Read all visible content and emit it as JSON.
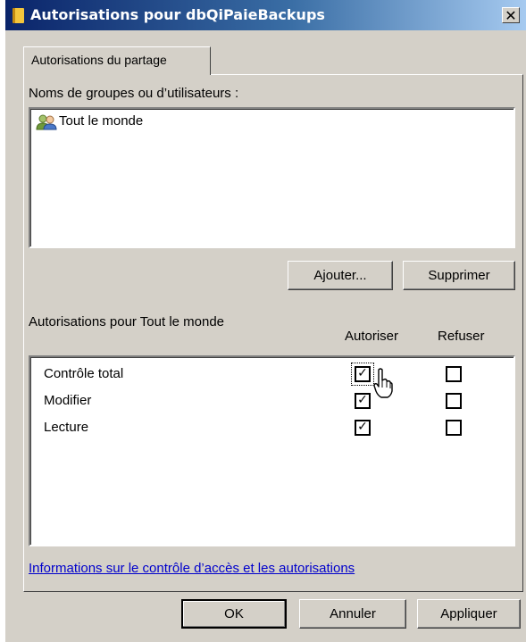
{
  "window": {
    "title": "Autorisations pour dbQiPaieBackups",
    "close_glyph": "✕"
  },
  "tab": {
    "label": "Autorisations du partage"
  },
  "users": {
    "label": "Noms de groupes ou d’utilisateurs :",
    "items": [
      {
        "label": "Tout le monde",
        "icon": "users-group-icon"
      }
    ]
  },
  "buttons": {
    "add": "Ajouter...",
    "remove": "Supprimer"
  },
  "permissions": {
    "label": "Autorisations pour Tout le monde",
    "allow_header": "Autoriser",
    "deny_header": "Refuser",
    "rows": [
      {
        "name": "Contrôle total",
        "allow": true,
        "deny": false
      },
      {
        "name": "Modifier",
        "allow": true,
        "deny": false
      },
      {
        "name": "Lecture",
        "allow": true,
        "deny": false
      }
    ]
  },
  "link": {
    "label": "Informations sur le contrôle d’accès et les autorisations"
  },
  "footer": {
    "ok": "OK",
    "cancel": "Annuler",
    "apply": "Appliquer"
  },
  "colors": {
    "title_start": "#0a246a",
    "title_end": "#a6caf0",
    "face": "#d4d0c8",
    "link": "#0000cc"
  }
}
